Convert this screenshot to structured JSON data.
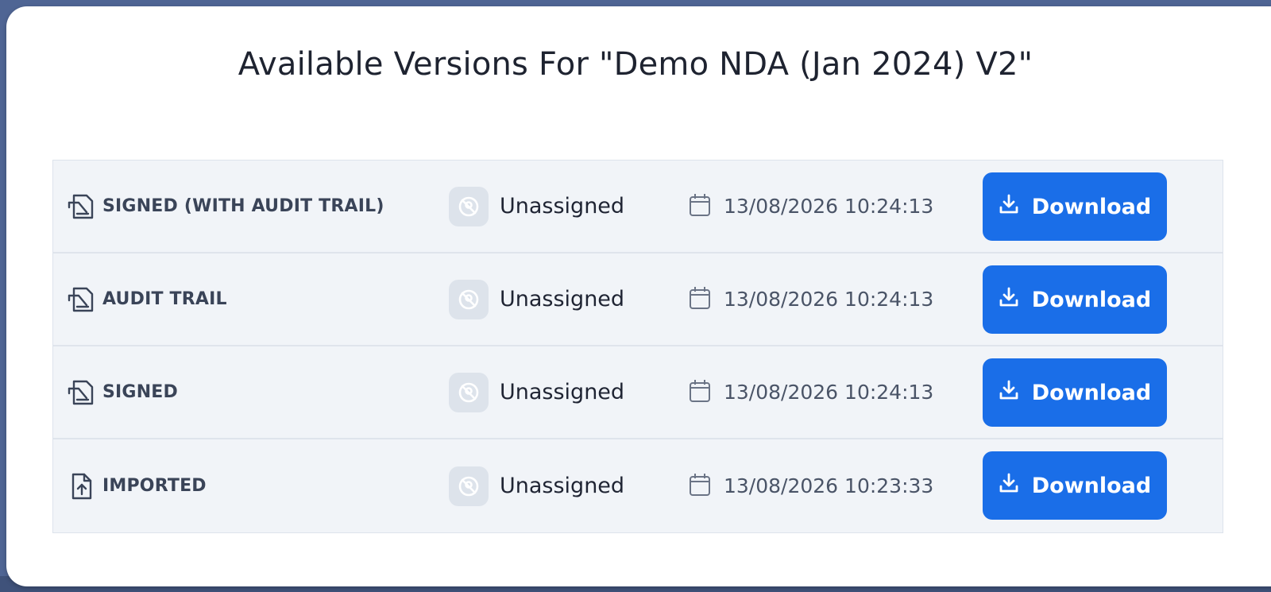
{
  "modal": {
    "title": "Available Versions For \"Demo NDA (Jan 2024) V2\""
  },
  "versions": [
    {
      "type_label": "SIGNED (WITH AUDIT TRAIL)",
      "type_icon": "signature-document-icon",
      "assignee": "Unassigned",
      "timestamp": "13/08/2026 10:24:13",
      "download_label": "Download"
    },
    {
      "type_label": "AUDIT TRAIL",
      "type_icon": "signature-document-icon",
      "assignee": "Unassigned",
      "timestamp": "13/08/2026 10:24:13",
      "download_label": "Download"
    },
    {
      "type_label": "SIGNED",
      "type_icon": "signature-document-icon",
      "assignee": "Unassigned",
      "timestamp": "13/08/2026 10:24:13",
      "download_label": "Download"
    },
    {
      "type_label": "IMPORTED",
      "type_icon": "file-upload-icon",
      "assignee": "Unassigned",
      "timestamp": "13/08/2026 10:23:33",
      "download_label": "Download"
    }
  ],
  "colors": {
    "accent": "#1a6ee8",
    "backdrop": "#4f6594",
    "row_background": "#f1f4f8"
  }
}
